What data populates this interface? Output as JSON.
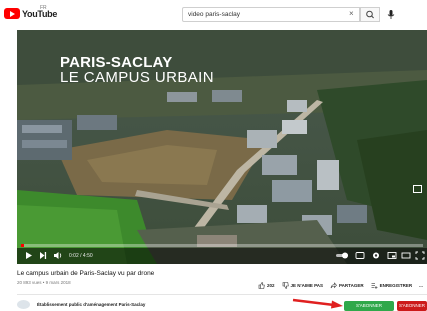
{
  "header": {
    "logo_text": "YouTube",
    "logo_sup": "FR",
    "search_value": "video paris-saclay",
    "search_clear": "×"
  },
  "player": {
    "overlay_line1": "PARIS-SACLAY",
    "overlay_line2": "LE CAMPUS URBAIN",
    "time": "0:02 / 4:50",
    "progress": 0.007
  },
  "video": {
    "title": "Le campus urbain de Paris-Saclay vu par drone",
    "meta": "20 893 vues • 9 mars 2018",
    "likes": "202",
    "dislike_label": "JE N'AIME PAS",
    "share_label": "PARTAGER",
    "save_label": "ENREGISTRER",
    "more_label": "..."
  },
  "channel": {
    "name": "Établissement public d'aménagement Paris-Saclay",
    "join_label": "S'ABONNER",
    "subscribe_label": "S'ABONNER"
  },
  "colors": {
    "accent": "#ff0000",
    "arrow": "#e02020",
    "join": "#2fa84a",
    "subscribe": "#cc1a1a"
  }
}
